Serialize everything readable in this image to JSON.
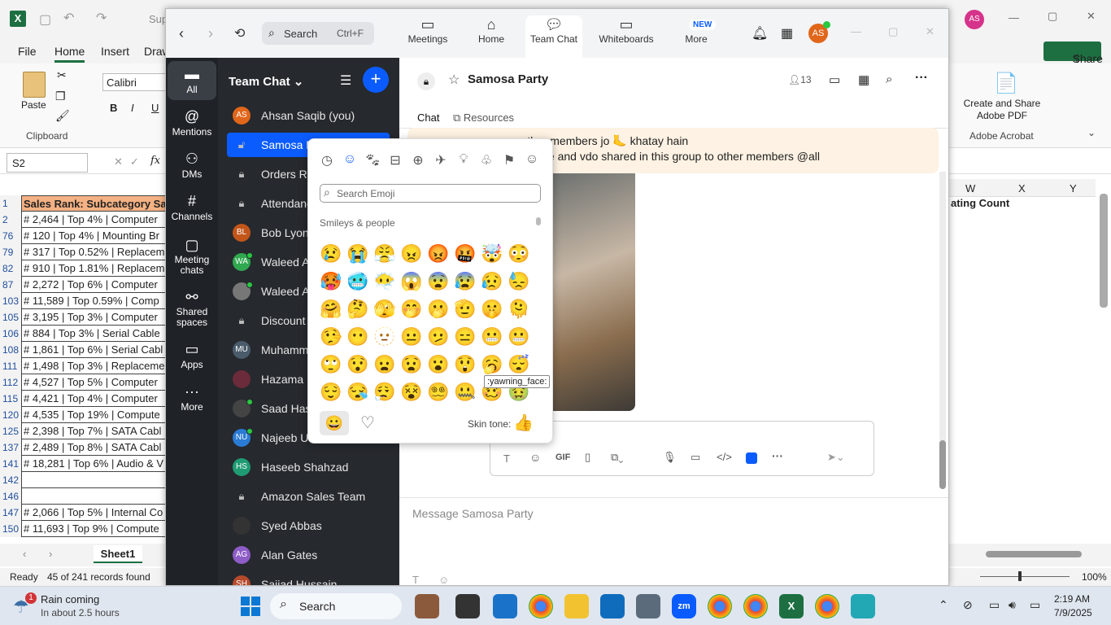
{
  "excel": {
    "title_fragment": "Sup",
    "tabs": [
      "File",
      "Home",
      "Insert",
      "Draw"
    ],
    "active_tab": "Home",
    "paste_label": "Paste",
    "clipboard_label": "Clipboard",
    "font_name": "Calibri",
    "name_box": "S2",
    "fx": "fx",
    "share_label": "Share",
    "acrobat_button": "Create and Share Adobe PDF",
    "acrobat_group": "Adobe Acrobat",
    "col_headers": [
      "W",
      "X",
      "Y"
    ],
    "right_header": "ating Count",
    "rows": [
      {
        "n": "1",
        "v": "Sales Rank: Subcategory Sale"
      },
      {
        "n": "2",
        "v": "# 2,464 | Top 4% | Computer"
      },
      {
        "n": "76",
        "v": "# 120 | Top 4% | Mounting Br"
      },
      {
        "n": "79",
        "v": "# 317 | Top 0.52% | Replacem"
      },
      {
        "n": "82",
        "v": "# 910 | Top 1.81% | Replacem"
      },
      {
        "n": "87",
        "v": "# 2,272 | Top 6% | Computer"
      },
      {
        "n": "103",
        "v": "# 11,589 | Top 0.59% | Comp"
      },
      {
        "n": "105",
        "v": "# 3,195 | Top 3% | Computer"
      },
      {
        "n": "106",
        "v": "# 884 | Top 3% | Serial Cable"
      },
      {
        "n": "108",
        "v": "# 1,861 | Top 6% | Serial Cabl"
      },
      {
        "n": "111",
        "v": "# 1,498 | Top 3% | Replaceme"
      },
      {
        "n": "112",
        "v": "# 4,527 | Top 5% | Computer"
      },
      {
        "n": "115",
        "v": "# 4,421 | Top 4% | Computer"
      },
      {
        "n": "120",
        "v": "# 4,535 | Top 19% | Compute"
      },
      {
        "n": "125",
        "v": "# 2,398 | Top 7% | SATA Cabl"
      },
      {
        "n": "137",
        "v": "# 2,489 | Top 8% | SATA Cabl"
      },
      {
        "n": "141",
        "v": "# 18,281 | Top 6% | Audio & V"
      },
      {
        "n": "142",
        "v": ""
      },
      {
        "n": "146",
        "v": ""
      },
      {
        "n": "147",
        "v": "# 2,066 | Top 5% | Internal Co"
      },
      {
        "n": "150",
        "v": "# 11,693 | Top 9% | Compute"
      }
    ],
    "sheet_tab": "Sheet1",
    "status_ready": "Ready",
    "status_records": "45 of 241 records found",
    "zoom_level": "100%"
  },
  "zoom": {
    "search_placeholder": "Search",
    "search_shortcut": "Ctrl+F",
    "nav": [
      {
        "label": "Meetings",
        "icon": "video-icon"
      },
      {
        "label": "Home",
        "icon": "home-icon"
      },
      {
        "label": "Team Chat",
        "icon": "chat-icon"
      },
      {
        "label": "Whiteboards",
        "icon": "whiteboard-icon"
      },
      {
        "label": "More",
        "icon": "more-icon"
      }
    ],
    "new_badge": "NEW",
    "avatar_initials": "AS",
    "rail": [
      {
        "label": "All",
        "icon": "chat-bubble-icon"
      },
      {
        "label": "Mentions",
        "icon": "at-icon"
      },
      {
        "label": "DMs",
        "icon": "people-icon"
      },
      {
        "label": "Channels",
        "icon": "hash-icon"
      },
      {
        "label": "Meeting chats",
        "icon": "calendar-icon"
      },
      {
        "label": "Shared spaces",
        "icon": "share-nodes-icon"
      },
      {
        "label": "Apps",
        "icon": "apps-icon"
      },
      {
        "label": "More",
        "icon": "dots-icon"
      }
    ],
    "list_title": "Team Chat",
    "chats": [
      {
        "name": "Ahsan Saqib (you)",
        "init": "AS",
        "color": "#e0661a",
        "online": false
      },
      {
        "name": "Samosa Party",
        "init": "",
        "color": "",
        "online": false
      },
      {
        "name": "Orders Re",
        "init": "",
        "color": "",
        "online": false
      },
      {
        "name": "Attendanc",
        "init": "",
        "color": "",
        "online": false
      },
      {
        "name": "Bob Lyon",
        "init": "BL",
        "color": "#c2561a",
        "online": false
      },
      {
        "name": "Waleed Ah",
        "init": "WA",
        "color": "#2fa84f",
        "online": true
      },
      {
        "name": "Waleed Al",
        "init": "",
        "color": "#777",
        "online": true
      },
      {
        "name": "Discount &",
        "init": "",
        "color": "",
        "online": false
      },
      {
        "name": "Muhamm",
        "init": "MU",
        "color": "#4a5b6b",
        "online": false
      },
      {
        "name": "Hazama N",
        "init": "",
        "color": "#6b2b3a",
        "online": false
      },
      {
        "name": "Saad Has",
        "init": "",
        "color": "#444",
        "online": true
      },
      {
        "name": "Najeeb U",
        "init": "NU",
        "color": "#2a7bd4",
        "online": true
      },
      {
        "name": "Haseeb Shahzad",
        "init": "HS",
        "color": "#1f9b73",
        "online": false
      },
      {
        "name": "Amazon Sales Team",
        "init": "",
        "color": "",
        "online": false
      },
      {
        "name": "Syed Abbas",
        "init": "",
        "color": "#333",
        "online": false
      },
      {
        "name": "Alan Gates",
        "init": "AG",
        "color": "#8e5cc7",
        "online": false
      },
      {
        "name": "Sajjad Hussain",
        "init": "SH",
        "color": "#b54a2b",
        "online": false
      }
    ],
    "channel_title": "Samosa Party",
    "member_count": "13",
    "tab_chat": "Chat",
    "tab_resources": "Resources",
    "msg_line1": "ng other members jo 🦶 khatay hain",
    "msg_line2": "ay picture and vdo shared in this group to other members @all",
    "compose_placeholder": "Message Samosa Party",
    "picker": {
      "search_placeholder": "Search Emoji",
      "section": "Smileys & people",
      "tooltip": ":yawning_face:",
      "skin_tone_label": "Skin tone:",
      "rows": [
        [
          "😢",
          "😭",
          "😤",
          "😠",
          "😡",
          "🤬",
          "🤯",
          "😳"
        ],
        [
          "🥵",
          "🥶",
          "😶‍🌫️",
          "😱",
          "😨",
          "😰",
          "😥",
          "😓"
        ],
        [
          "🤗",
          "🤔",
          "🫣",
          "🤭",
          "🫢",
          "🫡",
          "🤫",
          "🫠"
        ],
        [
          "🤥",
          "😶",
          "🫥",
          "😐",
          "🫤",
          "😑",
          "😬",
          "😬"
        ],
        [
          "🙄",
          "😯",
          "😦",
          "😧",
          "😮",
          "😲",
          "🥱",
          "😴"
        ],
        [
          "😌",
          "😪",
          "😮‍💨",
          "😵",
          "😵‍💫",
          "🤐",
          "🥴",
          "🤢"
        ]
      ]
    }
  },
  "taskbar": {
    "weather_title": "Rain coming",
    "weather_sub": "In about 2.5 hours",
    "weather_badge": "1",
    "search_label": "Search",
    "time": "2:19 AM",
    "date": "7/9/2025"
  }
}
